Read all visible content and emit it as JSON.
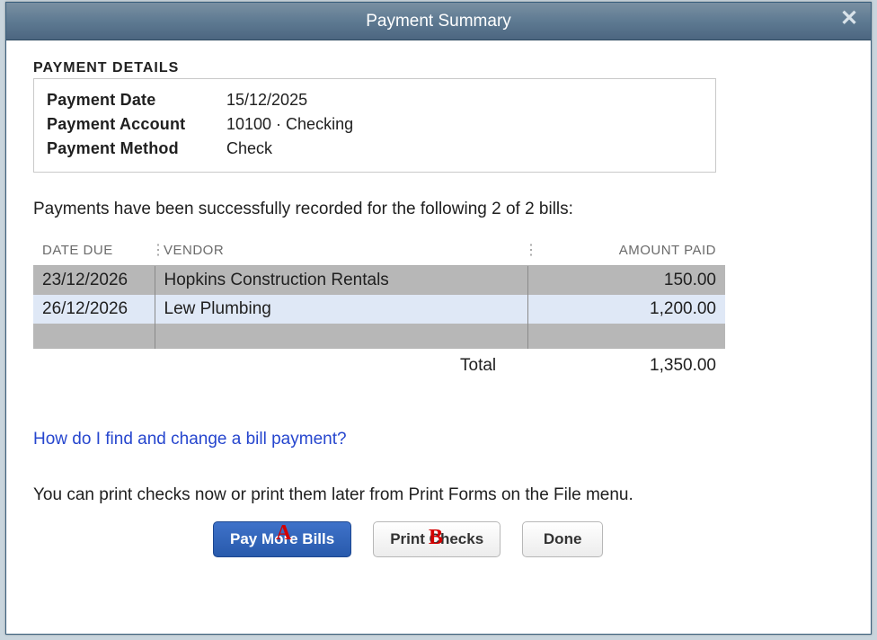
{
  "window": {
    "title": "Payment Summary"
  },
  "details": {
    "section_title": "PAYMENT DETAILS",
    "labels": {
      "date": "Payment Date",
      "account": "Payment Account",
      "method": "Payment Method"
    },
    "values": {
      "date": "15/12/2025",
      "account": "10100 · Checking",
      "method": "Check"
    }
  },
  "success_message": "Payments have been successfully recorded for the following 2 of 2 bills:",
  "table": {
    "headers": {
      "date_due": "DATE DUE",
      "vendor": "VENDOR",
      "amount_paid": "AMOUNT PAID"
    },
    "rows": [
      {
        "date_due": "23/12/2026",
        "vendor": "Hopkins Construction Rentals",
        "amount_paid": "150.00"
      },
      {
        "date_due": "26/12/2026",
        "vendor": "Lew Plumbing",
        "amount_paid": "1,200.00"
      }
    ],
    "total_label": "Total",
    "total_value": "1,350.00"
  },
  "help_link": "How do I find and change a bill payment?",
  "hint": "You can print checks now or print them later from Print Forms on the File menu.",
  "annotations": {
    "a": "A",
    "b": "B"
  },
  "buttons": {
    "pay_more": "Pay More Bills",
    "print_checks": "Print Checks",
    "done": "Done"
  }
}
